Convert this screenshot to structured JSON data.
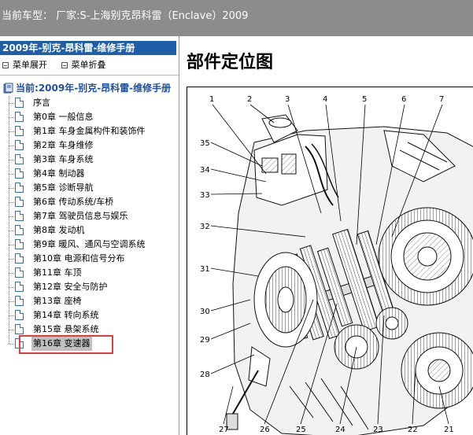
{
  "topbar": {
    "title": "当前车型： 厂家:S-上海别克昂科雷（Enclave）2009"
  },
  "sidebar": {
    "book_title": "2009年-别克-昂科雷-维修手册",
    "expand_label": "菜单展开",
    "collapse_label": "菜单折叠",
    "root_prefix": "当前:",
    "root_label": "2009年-别克-昂科雷-维修手册",
    "items": [
      {
        "label": "序言"
      },
      {
        "label": "第0章 一般信息"
      },
      {
        "label": "第1章 车身金属构件和装饰件"
      },
      {
        "label": "第2章 车身维修"
      },
      {
        "label": "第3章 车身系统"
      },
      {
        "label": "第4章 制动器"
      },
      {
        "label": "第5章 诊断导航"
      },
      {
        "label": "第6章 传动系统/车桥"
      },
      {
        "label": "第7章 驾驶员信息与娱乐"
      },
      {
        "label": "第8章 发动机"
      },
      {
        "label": "第9章 暖风、通风与空调系统"
      },
      {
        "label": "第10章 电源和信号分布"
      },
      {
        "label": "第11章 车顶"
      },
      {
        "label": "第12章 安全与防护"
      },
      {
        "label": "第13章 座椅"
      },
      {
        "label": "第14章 转向系统"
      },
      {
        "label": "第15章 悬架系统"
      },
      {
        "label": "第16章 变速器",
        "selected": true
      }
    ]
  },
  "content": {
    "page_title": "部件定位图",
    "callouts": [
      "1",
      "2",
      "3",
      "4",
      "5",
      "6",
      "7",
      "35",
      "34",
      "33",
      "32",
      "31",
      "30",
      "29",
      "28",
      "27",
      "26",
      "25",
      "24",
      "23",
      "22",
      "21"
    ]
  },
  "colors": {
    "topbar_bg": "#8c8c8c",
    "header_bg": "#1f5fa7",
    "selection_outline": "#e53c3c"
  }
}
